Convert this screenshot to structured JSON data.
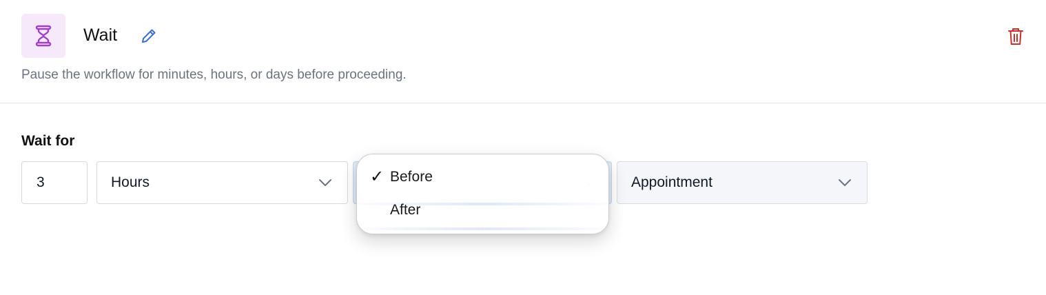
{
  "header": {
    "title": "Wait",
    "icon": "hourglass-icon",
    "description": "Pause the workflow for minutes, hours, or days before proceeding."
  },
  "colors": {
    "icon_bg": "#f5e9fb",
    "icon_color": "#a33fc6",
    "edit_color": "#3b6fd0",
    "delete_color": "#c8312b"
  },
  "form": {
    "label": "Wait for",
    "amount": "3",
    "unit": "Hours",
    "relation_options": [
      "Before",
      "After"
    ],
    "relation_selected": "Before",
    "target": "Appointment"
  }
}
